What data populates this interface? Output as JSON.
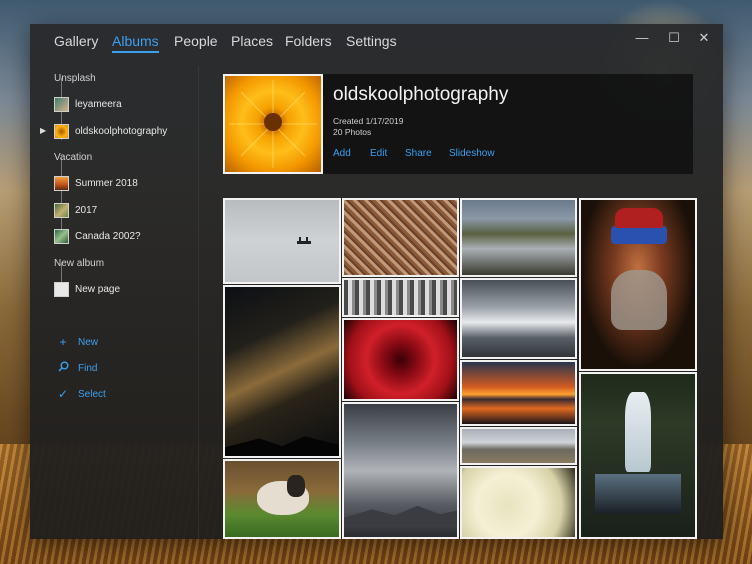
{
  "nav": {
    "tabs": [
      {
        "label": "Gallery"
      },
      {
        "label": "Albums",
        "active": true
      },
      {
        "label": "People"
      },
      {
        "label": "Places"
      },
      {
        "label": "Folders"
      },
      {
        "label": "Settings"
      }
    ]
  },
  "window_controls": {
    "minimize": "—",
    "maximize": "☐",
    "close": "✕"
  },
  "sidebar": {
    "groups": [
      {
        "title": "Unsplash",
        "items": [
          "leyameera",
          "oldskoolphotography"
        ]
      },
      {
        "title": "Vacation",
        "items": [
          "Summer 2018",
          "2017",
          "Canada 2002?"
        ]
      },
      {
        "title": "New album",
        "items": [
          "New page"
        ]
      }
    ],
    "selected_item": "oldskoolphotography",
    "actions": [
      {
        "label": "New",
        "icon": "plus-icon"
      },
      {
        "label": "Find",
        "icon": "search-icon"
      },
      {
        "label": "Select",
        "icon": "checkmark-icon"
      }
    ]
  },
  "album": {
    "title": "oldskoolphotography",
    "created": "Created 1/17/2019",
    "count": "20 Photos",
    "actions": [
      "Add",
      "Edit",
      "Share",
      "Slideshow"
    ]
  },
  "photos": [
    {
      "subject": "misty lake with boat"
    },
    {
      "subject": "city rooftops"
    },
    {
      "subject": "river valley"
    },
    {
      "subject": "painted sadhu portrait"
    },
    {
      "subject": "black and white landscape"
    },
    {
      "subject": "milky way night sky"
    },
    {
      "subject": "cloudy mountains"
    },
    {
      "subject": "red rose"
    },
    {
      "subject": "sunset over lake"
    },
    {
      "subject": "stormy sky mountains"
    },
    {
      "subject": "mountain panorama"
    },
    {
      "subject": "waterfall"
    },
    {
      "subject": "sheep on grass"
    },
    {
      "subject": "white rose"
    }
  ]
}
